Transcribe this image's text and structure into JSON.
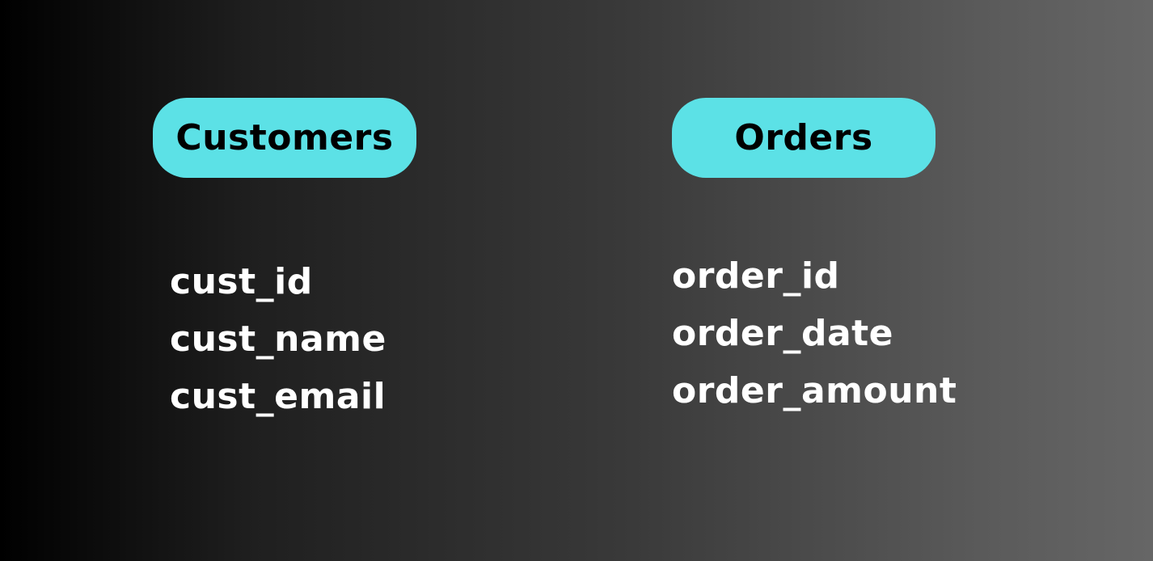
{
  "colors": {
    "header_bg": "#5ce1e6",
    "header_text": "#000000",
    "field_text": "#ffffff"
  },
  "tables": [
    {
      "name": "Customers",
      "fields": [
        "cust_id",
        "cust_name",
        "cust_email"
      ]
    },
    {
      "name": "Orders",
      "fields": [
        "order_id",
        "order_date",
        "order_amount"
      ]
    }
  ]
}
